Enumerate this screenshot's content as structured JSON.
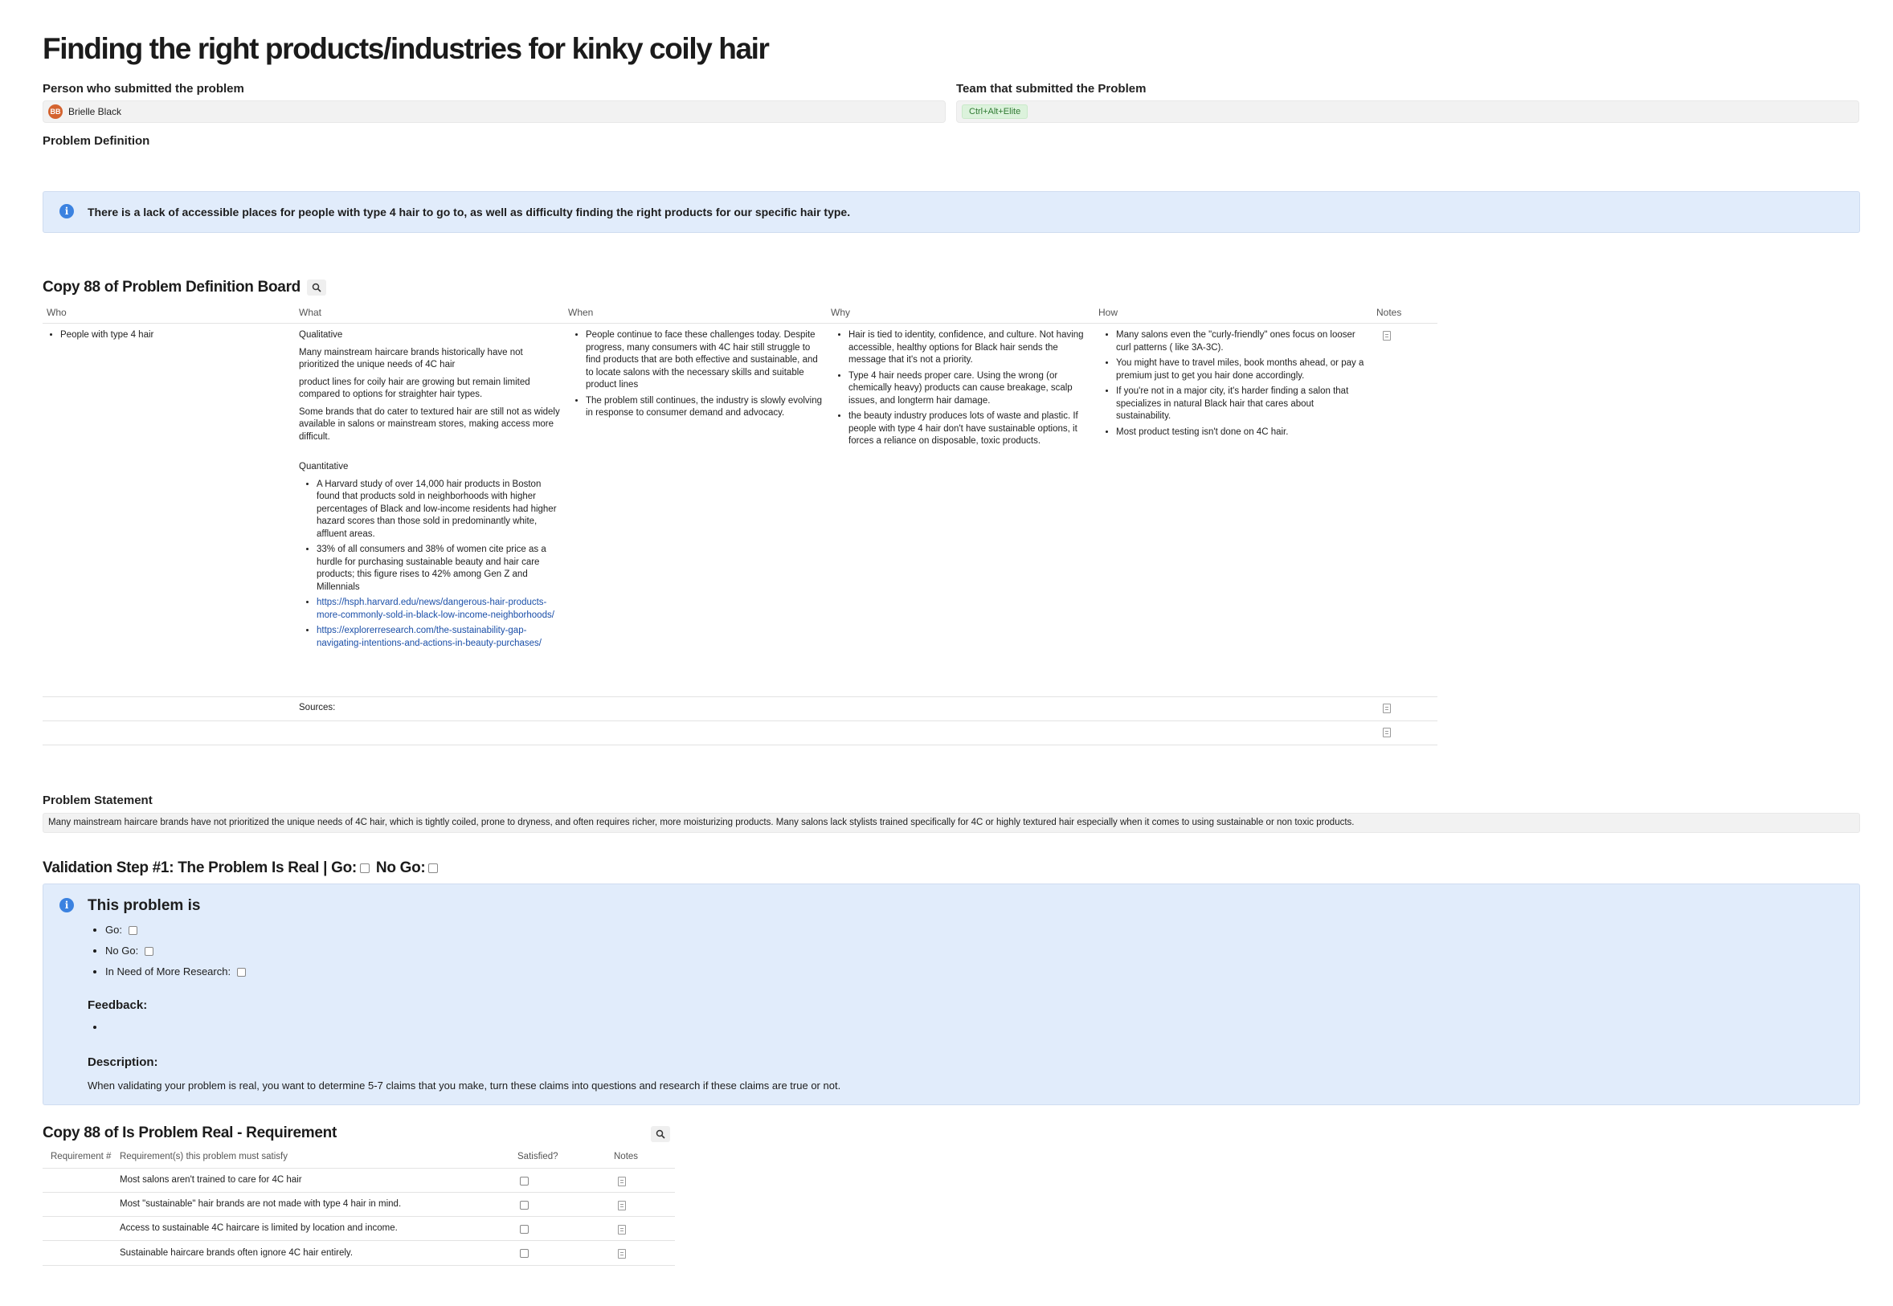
{
  "page": {
    "title": "Finding the right products/industries for kinky coily hair"
  },
  "properties": {
    "person_label": "Person who submitted the problem",
    "person_initials": "BB",
    "person_name": "Brielle Black",
    "team_label": "Team that submitted the Problem",
    "team_value": "Ctrl+Alt+Elite",
    "definition_label": "Problem Definition"
  },
  "callout_top": {
    "text": "There is a lack of accessible places for people with type 4 hair to go to, as well as difficulty finding the right products for our specific hair type."
  },
  "board": {
    "title": "Copy 88 of Problem Definition Board",
    "columns": [
      "Who",
      "What",
      "When",
      "Why",
      "How",
      "Notes"
    ],
    "who": [
      "People with type 4 hair"
    ],
    "what": {
      "qual_label": "Qualitative",
      "qual_paras": [
        "Many mainstream haircare brands historically have not prioritized the unique needs of 4C hair",
        "product lines for coily hair are growing but remain limited compared to options for straighter hair types.",
        "Some brands that do cater to textured hair are still not as widely available in salons or mainstream stores, making access more difficult."
      ],
      "quant_label": "Quantitative",
      "quant_items": [
        "A Harvard study of over 14,000 hair products in Boston found that products sold in neighborhoods with higher percentages of Black and low-income residents had higher hazard scores than those sold in predominantly white, affluent areas.",
        "33% of all consumers and 38% of women cite price as a hurdle for purchasing sustainable beauty and hair care products; this figure rises to 42% among Gen Z and Millennials"
      ],
      "links": [
        "https://hsph.harvard.edu/news/dangerous-hair-products-more-commonly-sold-in-black-low-income-neighborhoods/",
        "https://explorerresearch.com/the-sustainability-gap-navigating-intentions-and-actions-in-beauty-purchases/"
      ]
    },
    "when": [
      "People continue to face these challenges today. Despite progress, many consumers with 4C hair still struggle to find products that are both effective and sustainable, and to locate salons with the necessary skills and suitable product lines",
      "The problem still continues, the industry is slowly evolving in response to consumer demand and advocacy."
    ],
    "why": [
      "Hair is tied to identity, confidence, and culture. Not having accessible, healthy options for Black hair sends the message that it's not a priority.",
      "Type 4 hair needs proper care. Using the wrong (or chemically heavy) products can cause breakage, scalp issues, and longterm hair damage.",
      "the beauty industry produces lots of waste and plastic. If people with type 4 hair  don't have sustainable options, it forces a reliance on disposable, toxic products."
    ],
    "how": [
      "Many salons even the \"curly-friendly\" ones focus on looser curl patterns ( like 3A-3C).",
      "You might have to travel miles, book months ahead, or pay a premium just to get you hair done accordingly.",
      "If you're not in a major city, it's harder finding a salon that specializes in natural Black hair that cares about sustainability.",
      "Most product testing isn't done on 4C hair."
    ],
    "sources_label": "Sources:"
  },
  "statement": {
    "label": "Problem Statement",
    "text": "Many mainstream haircare brands have not prioritized the unique needs of 4C hair, which is tightly coiled, prone to dryness, and often requires richer, more moisturizing products. Many salons lack stylists trained specifically for 4C or highly textured hair especially when it comes to using sustainable or non toxic products."
  },
  "validation": {
    "title_part1": "Validation Step #1: The Problem Is Real | Go:",
    "title_part2": "No Go:",
    "callout_heading": "This problem is",
    "options": [
      "Go:",
      "No Go:",
      "In Need of More Research:"
    ],
    "feedback_label": "Feedback:",
    "description_label": "Description:",
    "description_text": "When validating your problem is real, you want to determine 5-7 claims that you make, turn these claims into questions and research if these claims are true or not."
  },
  "requirements": {
    "title": "Copy 88 of Is Problem Real - Requirement",
    "columns": [
      "Requirement #",
      "Requirement(s) this problem must satisfy",
      "Satisfied?",
      "Notes"
    ],
    "rows": [
      "Most salons aren't trained to care for 4C hair",
      "Most \"sustainable\" hair brands are not made with type 4 hair in mind.",
      "Access to sustainable 4C haircare is limited by location and income.",
      "Sustainable haircare brands often ignore 4C hair entirely."
    ]
  },
  "icons": {
    "info": "info-icon",
    "search": "search-icon",
    "note": "note-icon",
    "checkbox": "checkbox-icon"
  },
  "colors": {
    "callout_bg": "#e1ecfb",
    "info_blue": "#3b82e0",
    "avatar": "#d4632f",
    "tag_bg": "#dcf2dc",
    "tag_text": "#2f7a32",
    "link": "#1b4fa8"
  }
}
